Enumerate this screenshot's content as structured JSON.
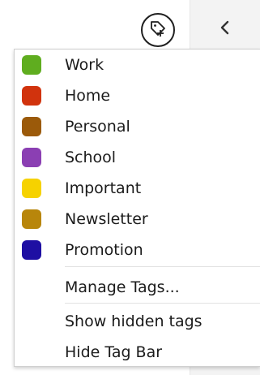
{
  "toolbar": {
    "add_tag_icon": "tag-plus-icon",
    "collapse_icon": "chevron-left-icon"
  },
  "tag_menu": {
    "tags": [
      {
        "label": "Work",
        "color": "#5fad1f"
      },
      {
        "label": "Home",
        "color": "#d1330d"
      },
      {
        "label": "Personal",
        "color": "#9b5a0a"
      },
      {
        "label": "School",
        "color": "#8b3fb3"
      },
      {
        "label": "Important",
        "color": "#f6d200"
      },
      {
        "label": "Newsletter",
        "color": "#b8860b"
      },
      {
        "label": "Promotion",
        "color": "#1e0fa3"
      }
    ],
    "manage_tags": "Manage Tags...",
    "show_hidden_tags": "Show hidden tags",
    "hide_tag_bar": "Hide Tag Bar"
  }
}
